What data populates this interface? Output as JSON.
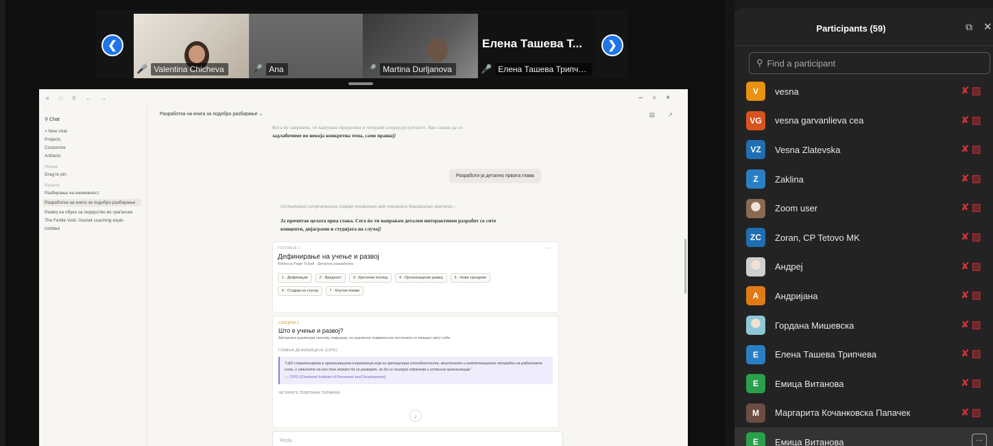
{
  "strip": {
    "participants": [
      {
        "name": "Valentina Chicheva"
      },
      {
        "name": "Ana"
      },
      {
        "name": "Martina Durljanova"
      },
      {
        "name": "Елена Ташева Трипче...",
        "display_title": "Елена Ташева Т..."
      }
    ],
    "prev_icon": "chevron-left-icon",
    "next_icon": "chevron-right-icon"
  },
  "shared_screen": {
    "sidebar": {
      "chat_label": "Chat",
      "nav": [
        "+ New chat",
        "Projects",
        "Customize",
        "Artifacts"
      ],
      "pinned_label": "Pinned",
      "drag_to_pin": "Drag to pin",
      "recents_label": "Recents",
      "recents": [
        "Разбирање на книжевност",
        "Разработка на книга за подобро разбирање",
        "Развој на обука за лидерство во граѓански",
        "The Fertile Void: Gestalt coaching explo",
        "Untitled"
      ]
    },
    "header_title": "Разработка на книга за подобро разбирање",
    "intro_lines": [
      "Кога ќе завршиш, ти кажуваш продолжи и поправи според резултатот. Ако сакаш да се",
      "задлабочиме во некоја конкретна тема, само прашај!"
    ],
    "user_message": "Разработи ја детално првата глава",
    "thinking": "Orchestrated comprehensive chapter breakdown with interactive Macedonian elements",
    "reply_lines": [
      "Ја прочитав целата прва глава. Сега ќе ти направам детален интерактивен разработ со сите",
      "концепти, дијаграми и студијата на случај!"
    ],
    "artifact": {
      "eyebrow": "ПОГЛАВЈЕ 1",
      "title": "Дефинирање на учење и развој",
      "subtitle": "Rebecca Page-Tickell · Детална разработка",
      "chips": [
        "1 · Дефиниции",
        "2 · Вредност",
        "3 · Критички поглед",
        "4 · Организациски развој",
        "5 · Нови трендови",
        "6 · Студија на случај",
        "7 · Клучни поими"
      ]
    },
    "section": {
      "eyebrow": "СЕКЦИЈА 1",
      "title": "Што е учење и развој?",
      "description": "Авторката разликува неколку поврзани, но различни термини кои честопати се мешаат меѓу себе.",
      "label": "ГЛАВНА ДЕФИНИЦИЈА (CIPD)",
      "quote": "\"L&D стратегијата е организациска стратегија која ги артикулира способностите, вештините и компетенциите потребни на работната сила, и начините на кои тие можат да се развијат, за да се осигура одржлива и успешна организација.\"",
      "quote_source": "— CIPD (Chartered Institute of Personnel and Development)",
      "label2": "ЧЕТИРИТЕ ПОВРЗАНИ ТЕРМИНИ"
    },
    "reply_placeholder": "Reply..."
  },
  "panel": {
    "title": "Participants (59)",
    "search_placeholder": "Find a participant",
    "participants": [
      {
        "initials": "V",
        "name": "vesna",
        "color": "#e8920f"
      },
      {
        "initials": "VG",
        "name": "vesna garvanlieva cea",
        "color": "#d9531e"
      },
      {
        "initials": "VZ",
        "name": "Vesna Zlatevska",
        "color": "#1f6fb2"
      },
      {
        "initials": "Z",
        "name": "Zaklina",
        "color": "#2a7fc4"
      },
      {
        "initials": "",
        "name": "Zoom user",
        "color": "#8a6a52",
        "photo": true
      },
      {
        "initials": "ZC",
        "name": "Zoran, CP Tetovo MK",
        "color": "#1f6fb2"
      },
      {
        "initials": "",
        "name": "Андреј",
        "color": "#cfcfcf",
        "photo": true
      },
      {
        "initials": "A",
        "name": "Андријана",
        "color": "#e07a16"
      },
      {
        "initials": "",
        "name": "Гордана Мишевска",
        "color": "#8fc7d8",
        "photo": true
      },
      {
        "initials": "E",
        "name": "Елена Ташева Трипчева",
        "color": "#2a7fc4"
      },
      {
        "initials": "E",
        "name": "Емица Витанова",
        "color": "#2aa04a"
      },
      {
        "initials": "M",
        "name": "Маргарита Кочанковска Папачек",
        "color": "#6b4d43"
      },
      {
        "initials": "E",
        "name": "Емица Витанова",
        "color": "#2aa04a",
        "highlighted": true
      }
    ]
  }
}
